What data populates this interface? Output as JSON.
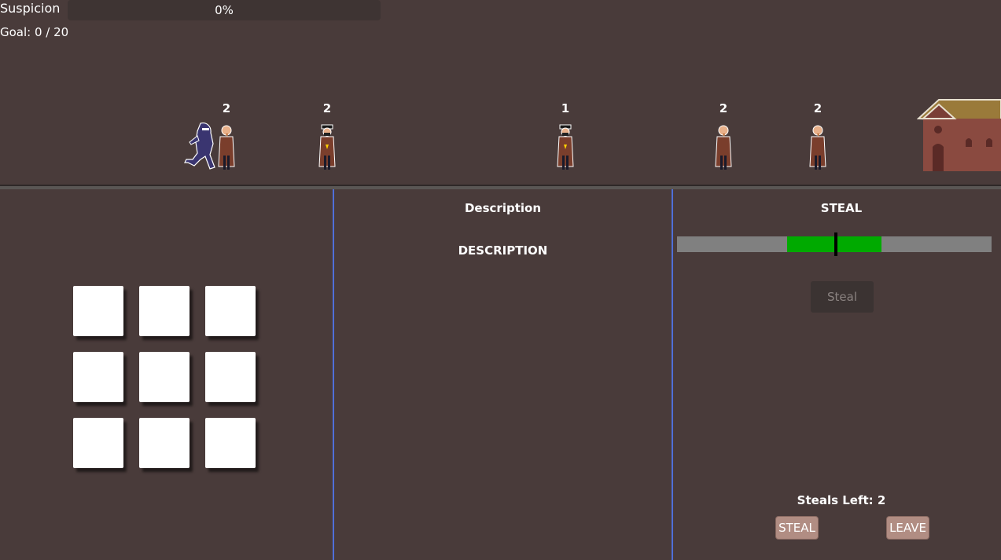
{
  "hud": {
    "suspicion_label": "Suspicion",
    "suspicion_value": "0%",
    "suspicion_level": 0,
    "goal_label": "Goal: 0 / 20"
  },
  "street": {
    "npcs": [
      {
        "count": "2"
      },
      {
        "count": "2"
      },
      {
        "count": "1"
      },
      {
        "count": "2"
      },
      {
        "count": "2"
      }
    ]
  },
  "description_panel": {
    "title": "Description",
    "body": "DESCRIPTION"
  },
  "steal_panel": {
    "title": "STEAL",
    "meter": {
      "zone_start": 0.35,
      "zone_end": 0.65,
      "needle": 0.505
    },
    "steal_button_label": "Steal",
    "steals_left_label": "Steals Left: 2",
    "steal_action_label": "STEAL",
    "leave_action_label": "LEAVE"
  },
  "colors": {
    "background": "#493b3a",
    "divider": "#4f6fd8",
    "meter_zone": "#00aa00",
    "button": "#b18d83"
  }
}
